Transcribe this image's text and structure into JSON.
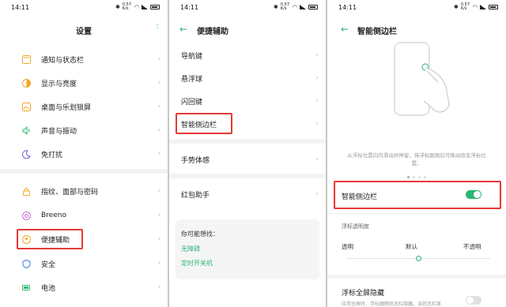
{
  "status": {
    "time": "14:11",
    "speed": "0.57 K/s"
  },
  "settings": {
    "title": "设置",
    "items": [
      {
        "label": "通知与状态栏"
      },
      {
        "label": "显示与亮度"
      },
      {
        "label": "桌面与乐划锁屏"
      },
      {
        "label": "声音与振动"
      },
      {
        "label": "免打扰"
      },
      {
        "label": "指纹、面部与密码"
      },
      {
        "label": "Breeno"
      },
      {
        "label": "便捷辅助"
      },
      {
        "label": "安全"
      },
      {
        "label": "电池"
      }
    ]
  },
  "convenience": {
    "title": "便捷辅助",
    "items": [
      {
        "label": "导航键"
      },
      {
        "label": "悬浮球"
      },
      {
        "label": "闪回键"
      },
      {
        "label": "智能侧边栏"
      },
      {
        "label": "手势体感"
      },
      {
        "label": "红包助手"
      }
    ],
    "suggest_title": "你可能想找：",
    "suggest_links": [
      "无障碍",
      "定时开关机"
    ]
  },
  "sidebar": {
    "title": "智能侧边栏",
    "desc": "从浮标位置向内滑动并停留，待浮标跟随后可拖动改变浮标位置。",
    "toggle_label": "智能侧边栏",
    "opacity_title": "浮标透明度",
    "opacity_labels": [
      "透明",
      "默认",
      "不透明"
    ],
    "opacity_level": 0.5,
    "fullscreen_title": "浮标全屏隐藏",
    "fullscreen_desc": "应用全屏时，浮标跟随状态栏隐藏。当状态栏显",
    "colors": {
      "accent": "#2bb673",
      "highlight": "#e53935"
    }
  }
}
